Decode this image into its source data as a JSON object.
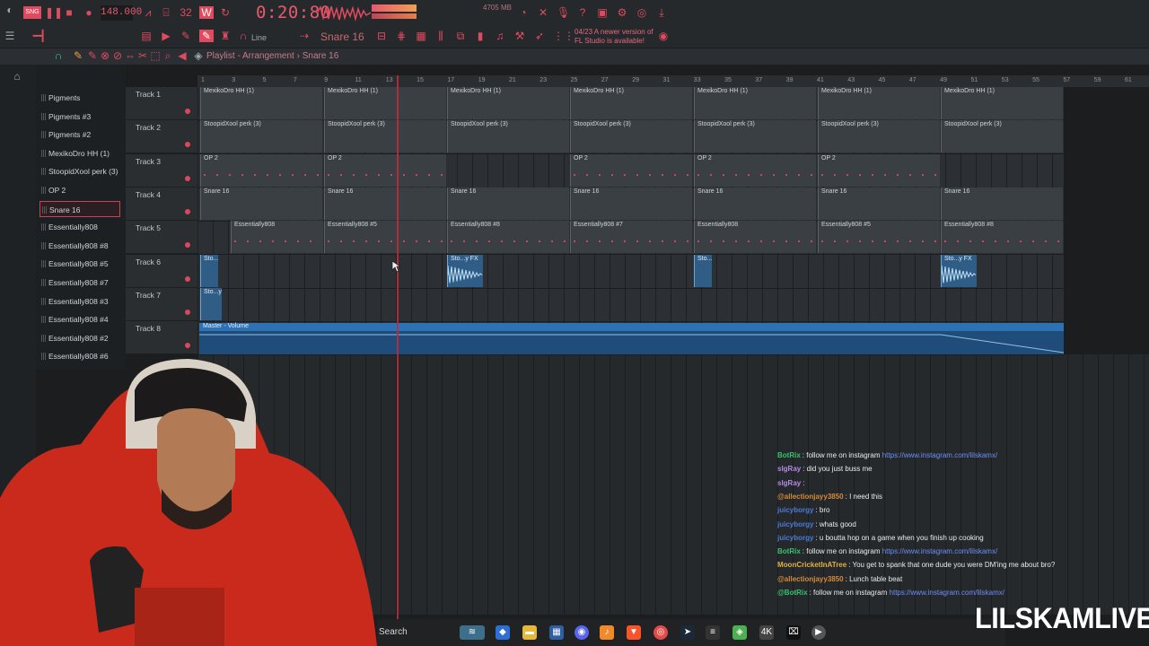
{
  "toolbar": {
    "tempo": "148.000",
    "time": "0:20:80",
    "memory": "4705 MB",
    "pattern": "Snare 16",
    "snap_mode": "Line",
    "news_line1": "04/23 A newer version of",
    "news_line2": "FL Studio is available!"
  },
  "playlist": {
    "title": "Playlist - Arrangement",
    "pattern": "Snare 16",
    "ruler": [
      "1",
      "3",
      "5",
      "7",
      "9",
      "11",
      "13",
      "15",
      "17",
      "19",
      "21",
      "23",
      "25",
      "27",
      "29",
      "31",
      "33",
      "35",
      "37",
      "39",
      "41",
      "43",
      "45",
      "47",
      "49",
      "51",
      "53",
      "55",
      "57",
      "59",
      "61"
    ]
  },
  "picker": [
    {
      "label": "Pigments"
    },
    {
      "label": "Pigments #3"
    },
    {
      "label": "Pigments #2"
    },
    {
      "label": "MexikoDro HH (1)"
    },
    {
      "label": "StoopidXool perk (3)"
    },
    {
      "label": "OP 2"
    },
    {
      "label": "Snare 16"
    },
    {
      "label": "Essentially808"
    },
    {
      "label": "Essentially808 #8"
    },
    {
      "label": "Essentially808 #5"
    },
    {
      "label": "Essentially808 #7"
    },
    {
      "label": "Essentially808 #3"
    },
    {
      "label": "Essentially808 #4"
    },
    {
      "label": "Essentially808 #2"
    },
    {
      "label": "Essentially808 #6"
    }
  ],
  "tracks": [
    "Track 1",
    "Track 2",
    "Track 3",
    "Track 4",
    "Track 5",
    "Track 6",
    "Track 7",
    "Track 8"
  ],
  "clips": {
    "t1": "MexikoDro HH (1)",
    "t2": "StoopidXool perk (3)",
    "t3": "OP 2",
    "t4": "Snare 16",
    "t5a": "Essentially808",
    "t5b": "Essentially808 #5",
    "t5c": "Essentially808 #8",
    "t5d": "Essentially808 #7",
    "t6": "Sto...y FX",
    "t8": "Master - Volume"
  },
  "chat": [
    {
      "user": "BotRix",
      "user_color": "#33c46b",
      "text": ": follow me on instagram ",
      "link": "https://www.instagram.com/lilskamx/"
    },
    {
      "user": "slgRay",
      "user_color": "#b48ae6",
      "text": ": did you just buss me",
      "link": ""
    },
    {
      "user": "slgRay",
      "user_color": "#b48ae6",
      "text": ":",
      "link": ""
    },
    {
      "user": "@allectionjayy3850",
      "user_color": "#d28a3a",
      "text": ": I need this",
      "link": ""
    },
    {
      "user": "juicyborgy",
      "user_color": "#4b7ad6",
      "text": ": bro",
      "link": ""
    },
    {
      "user": "juicyborgy",
      "user_color": "#4b7ad6",
      "text": ": whats good",
      "link": ""
    },
    {
      "user": "juicyborgy",
      "user_color": "#4b7ad6",
      "text": ": u boutta hop on a game when you finish up cooking",
      "link": ""
    },
    {
      "user": "BotRix",
      "user_color": "#33c46b",
      "text": ": follow me on instagram ",
      "link": "https://www.instagram.com/lilskamx/"
    },
    {
      "user": "MoonCricketInATree",
      "user_color": "#e0b04a",
      "text": ": You get to spank that one dude you were DM'ing me about bro?",
      "link": ""
    },
    {
      "user": "@allectionjayy3850",
      "user_color": "#d28a3a",
      "text": ": Lunch table beat",
      "link": ""
    },
    {
      "user": "@BotRix",
      "user_color": "#33c46b",
      "text": ": follow me on instagram ",
      "link": "https://www.instagram.com/lilskamx/"
    }
  ],
  "taskbar": {
    "search": "Search"
  },
  "overlay": {
    "brand": "LILSKAMLIVE"
  },
  "colors": {
    "accent": "#e04a5f",
    "playhead": "#c02c3e",
    "automation": "#2d72b5"
  }
}
